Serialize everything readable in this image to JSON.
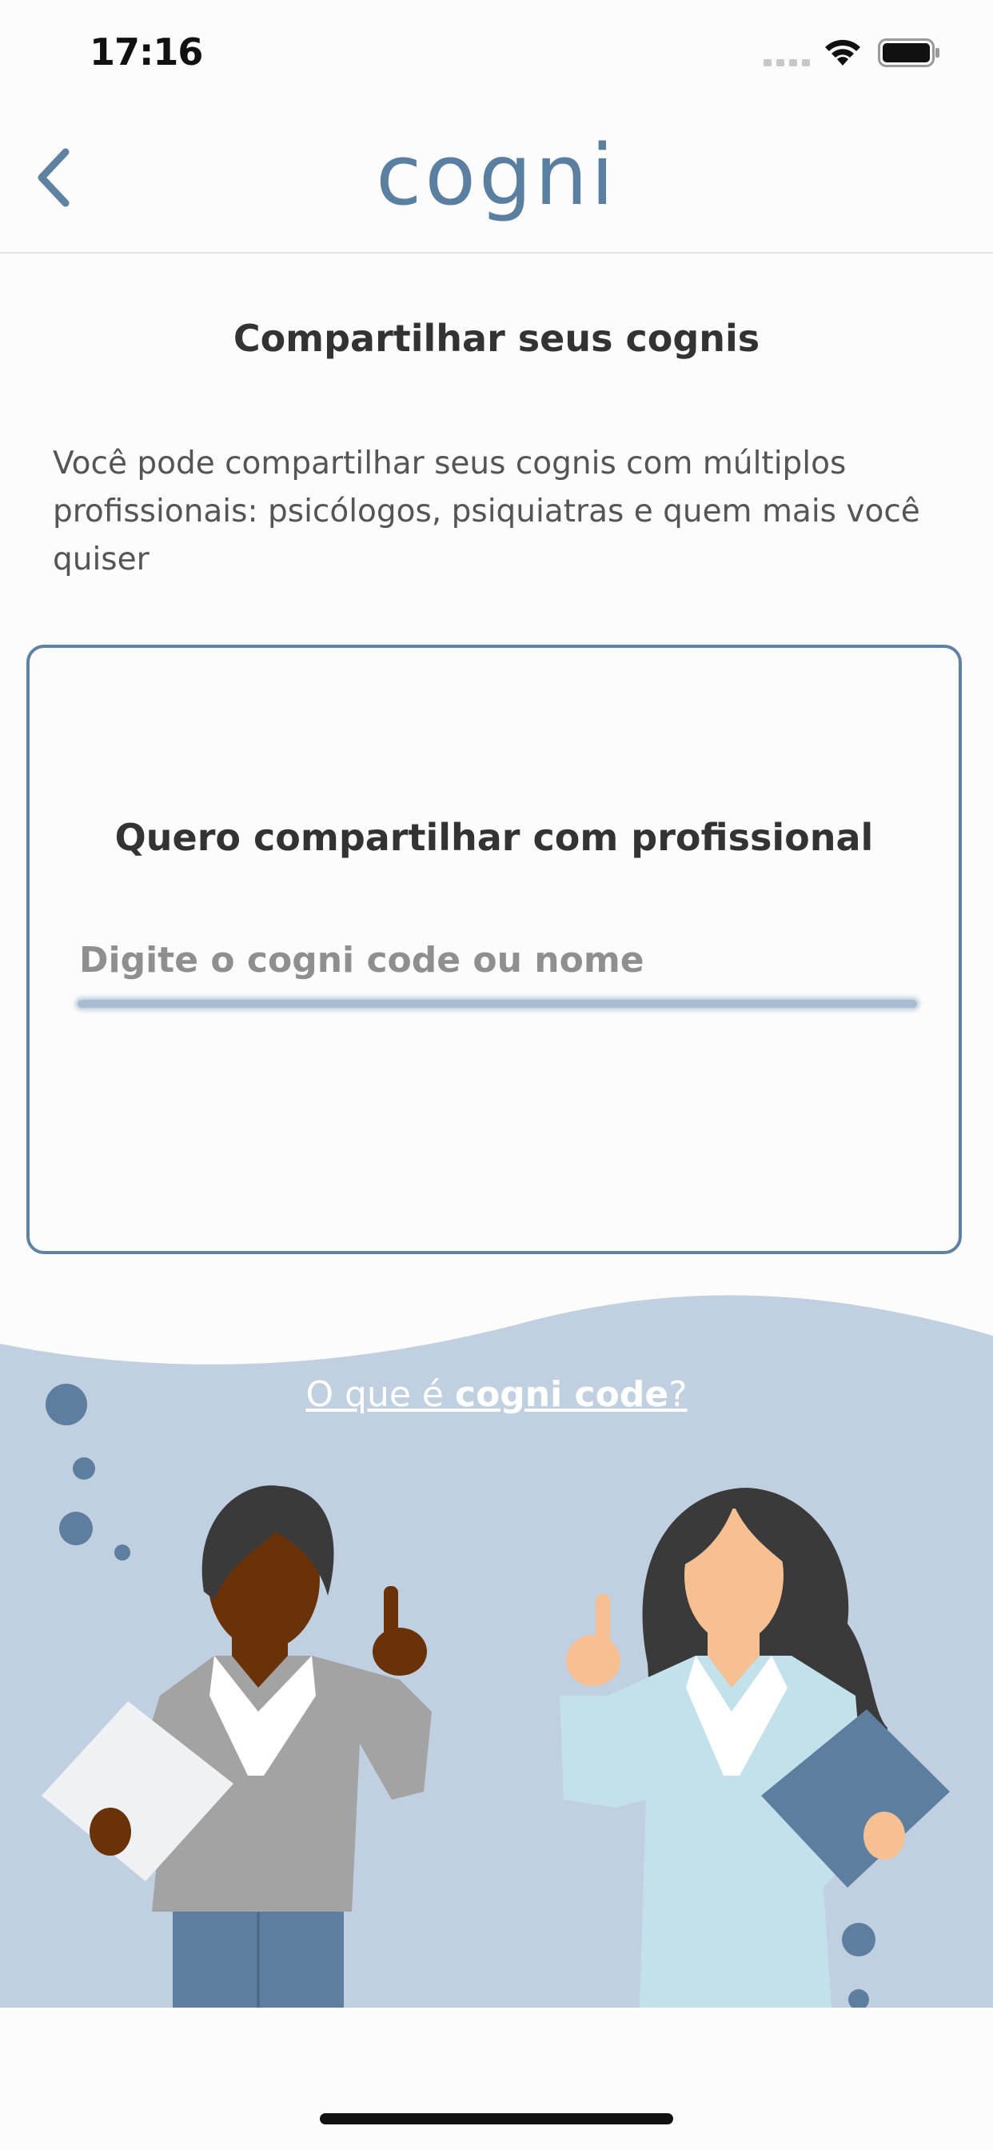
{
  "status_bar": {
    "time": "17:16"
  },
  "nav": {
    "logo": "cogni",
    "back_icon": "chevron-left-icon"
  },
  "page": {
    "title": "Compartilhar seus cognis",
    "description": "Você pode compartilhar seus cognis com múltiplos profissionais: psicólogos, psiquiatras e quem mais você quiser"
  },
  "share_card": {
    "title": "Quero compartilhar com profissional",
    "input_placeholder": "Digite o cogni code ou nome",
    "input_value": ""
  },
  "help_link": {
    "prefix": "O que é ",
    "bold": "cogni code",
    "suffix": "?"
  },
  "colors": {
    "accent": "#5f82a3",
    "illustration_bg": "#c0d0e0",
    "dot": "#5d7e9e"
  }
}
